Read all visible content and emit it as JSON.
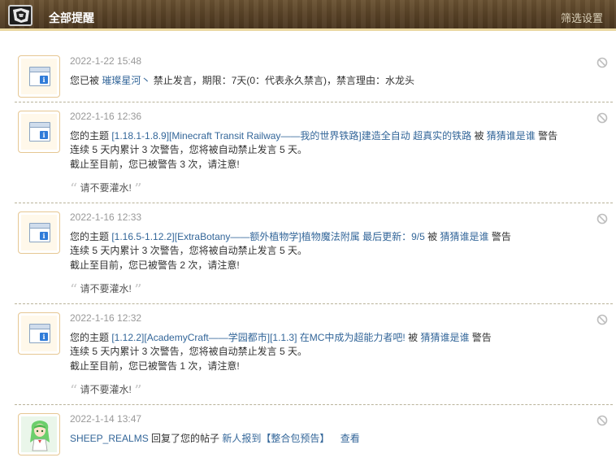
{
  "header": {
    "title": "全部提醒",
    "filter_label": "筛选设置"
  },
  "notices": [
    {
      "time": "2022-1-22 15:48",
      "line1": {
        "pre": "您已被 ",
        "user": "璀璨星河丶",
        "post": "  禁止发言，期限：7天(0：代表永久禁言)，禁言理由：水龙头"
      }
    },
    {
      "time": "2022-1-16 12:36",
      "line1": {
        "pre": "您的主题 ",
        "topic": "[1.18.1-1.8.9][Minecraft Transit Railway——我的世界铁路]建造全自动 超真实的铁路",
        "mid": " 被 ",
        "user": "猜猜谁是谁",
        "post": " 警告"
      },
      "line2": "连续 5 天内累计 3 次警告，您将被自动禁止发言 5 天。",
      "line3": "截止至目前，您已被警告 3 次，请注意!",
      "quote": "请不要灌水!"
    },
    {
      "time": "2022-1-16 12:33",
      "line1": {
        "pre": "您的主题 ",
        "topic": "[1.16.5-1.12.2][ExtraBotany——额外植物学]植物魔法附属 最后更新：9/5",
        "mid": " 被 ",
        "user": "猜猜谁是谁",
        "post": " 警告"
      },
      "line2": "连续 5 天内累计 3 次警告，您将被自动禁止发言 5 天。",
      "line3": "截止至目前，您已被警告 2 次，请注意!",
      "quote": "请不要灌水!"
    },
    {
      "time": "2022-1-16 12:32",
      "line1": {
        "pre": "您的主题 ",
        "topic": "[1.12.2][AcademyCraft——学园都市][1.1.3] 在MC中成为超能力者吧!",
        "mid": "  被 ",
        "user": "猜猜谁是谁",
        "post": " 警告"
      },
      "line2": "连续 5 天内累计 3 次警告，您将被自动禁止发言 5 天。",
      "line3": "截止至目前，您已被警告 1 次，请注意!",
      "quote": "请不要灌水!"
    },
    {
      "time": "2022-1-14 13:47",
      "line1": {
        "user": "SHEEP_REALMS",
        "mid": " 回复了您的帖子 ",
        "topic": "新人报到【整合包预告】",
        "view": "查看"
      }
    }
  ],
  "icons": {
    "system": "notice-window-icon",
    "delete": "delete-circle-icon",
    "logo": "site-logo-icon"
  }
}
